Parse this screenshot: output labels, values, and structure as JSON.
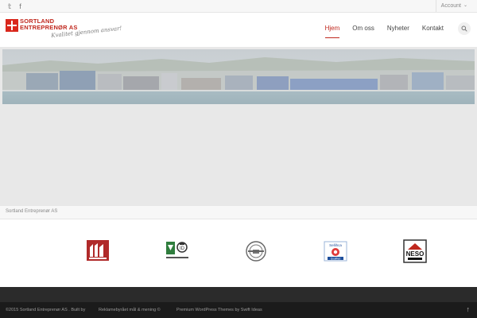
{
  "topbar": {
    "social": [
      {
        "icon": "twitter-icon",
        "glyph": "𝕥"
      },
      {
        "icon": "facebook-icon",
        "glyph": "f"
      }
    ],
    "account_label": "Account"
  },
  "header": {
    "logo_line1": "SORTLAND",
    "logo_line2": "ENTREPRENØR AS",
    "slogan": "Kvalitet gjennom ansvar!",
    "nav": [
      {
        "label": "Hjem",
        "active": true
      },
      {
        "label": "Om oss",
        "active": false
      },
      {
        "label": "Nyheter",
        "active": false
      },
      {
        "label": "Kontakt",
        "active": false
      }
    ]
  },
  "caption": "Sortland Entreprenør AS",
  "logos": {
    "neso_label": "NESO",
    "sellihca_label": "Sellihca",
    "qualified_label": "Qualified"
  },
  "footer": {
    "copyright": "©2015 Sortland Entreprenør AS . Built by",
    "credit": "Reklamebyrået mål & mening ©",
    "theme": "Premium WordPress Themes by Swift Ideas"
  },
  "colors": {
    "accent": "#c0281e",
    "dark": "#1b1b1b"
  }
}
